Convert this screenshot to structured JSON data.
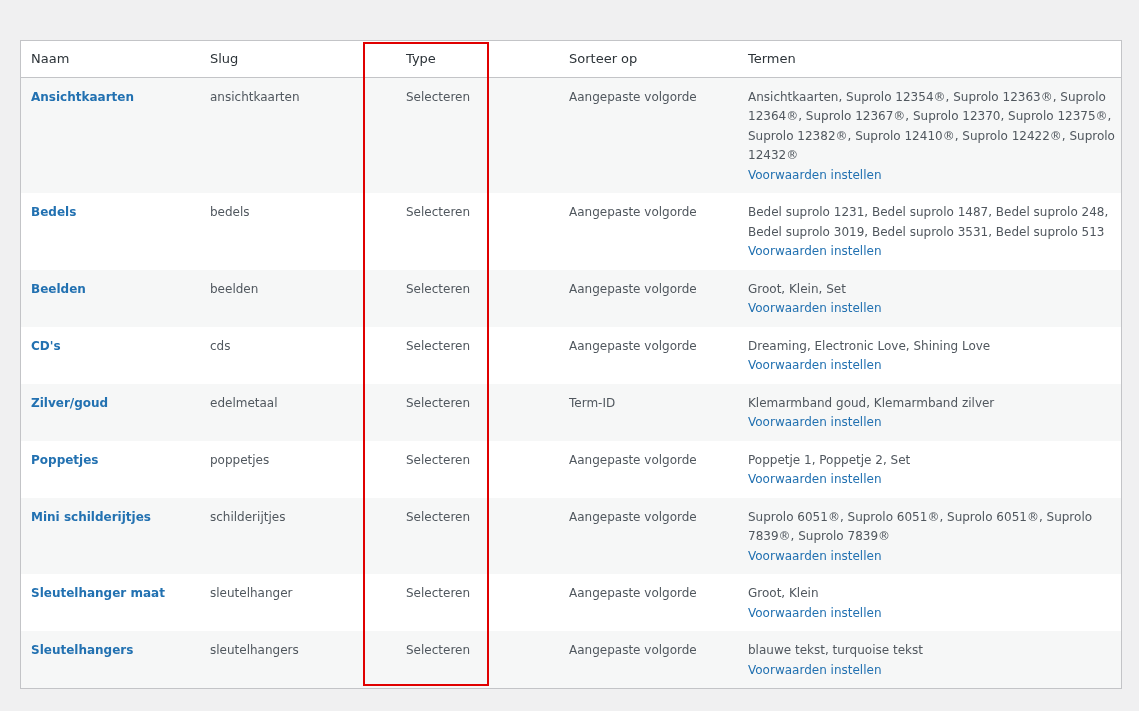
{
  "table": {
    "columns": [
      {
        "label": "Naam",
        "highlighted": false
      },
      {
        "label": "Slug",
        "highlighted": false
      },
      {
        "label": "Type",
        "highlighted": true
      },
      {
        "label": "Sorteer op",
        "highlighted": false
      },
      {
        "label": "Termen",
        "highlighted": false
      }
    ],
    "rows": [
      {
        "name": "Ansichtkaarten",
        "slug": "ansichtkaarten",
        "type": "Selecteren",
        "order": "Aangepaste volgorde",
        "terms": "Ansichtkaarten, Suprolo 12354®, Suprolo 12363®, Suprolo 12364®, Suprolo 12367®, Suprolo 12370, Suprolo 12375®, Suprolo 12382®, Suprolo 12410®, Suprolo 12422®, Suprolo 12432®",
        "link": "Voorwaarden instellen"
      },
      {
        "name": "Bedels",
        "slug": "bedels",
        "type": "Selecteren",
        "order": "Aangepaste volgorde",
        "terms": "Bedel suprolo 1231, Bedel suprolo 1487, Bedel suprolo 248, Bedel suprolo 3019, Bedel suprolo 3531, Bedel suprolo 513",
        "link": "Voorwaarden instellen"
      },
      {
        "name": "Beelden",
        "slug": "beelden",
        "type": "Selecteren",
        "order": "Aangepaste volgorde",
        "terms": "Groot, Klein, Set",
        "link": "Voorwaarden instellen"
      },
      {
        "name": "CD's",
        "slug": "cds",
        "type": "Selecteren",
        "order": "Aangepaste volgorde",
        "terms": "Dreaming, Electronic Love, Shining Love",
        "link": "Voorwaarden instellen"
      },
      {
        "name": "Zilver/goud",
        "slug": "edelmetaal",
        "type": "Selecteren",
        "order": "Term-ID",
        "terms": "Klemarmband goud, Klemarmband zilver",
        "link": "Voorwaarden instellen"
      },
      {
        "name": "Poppetjes",
        "slug": "poppetjes",
        "type": "Selecteren",
        "order": "Aangepaste volgorde",
        "terms": "Poppetje 1, Poppetje 2, Set",
        "link": "Voorwaarden instellen"
      },
      {
        "name": "Mini schilderijtjes",
        "slug": "schilderijtjes",
        "type": "Selecteren",
        "order": "Aangepaste volgorde",
        "terms": "Suprolo 6051®, Suprolo 6051®, Suprolo 6051®, Suprolo 7839®, Suprolo 7839®",
        "link": "Voorwaarden instellen"
      },
      {
        "name": "Sleutelhanger maat",
        "slug": "sleutelhanger",
        "type": "Selecteren",
        "order": "Aangepaste volgorde",
        "terms": "Groot, Klein",
        "link": "Voorwaarden instellen"
      },
      {
        "name": "Sleutelhangers",
        "slug": "sleutelhangers",
        "type": "Selecteren",
        "order": "Aangepaste volgorde",
        "terms": "blauwe tekst, turquoise tekst",
        "link": "Voorwaarden instellen"
      }
    ]
  }
}
